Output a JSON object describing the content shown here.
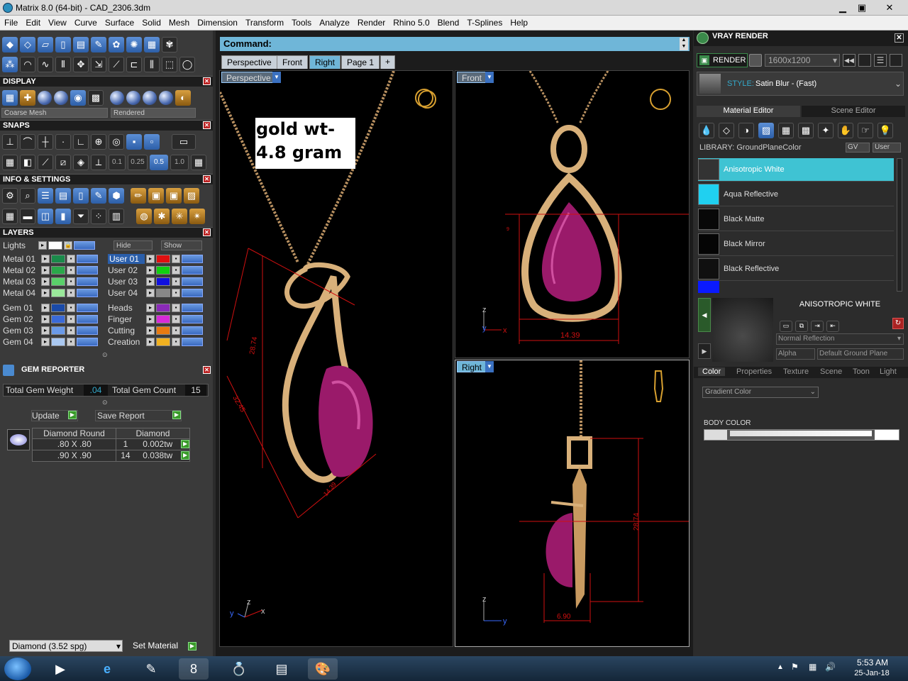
{
  "window": {
    "title": "Matrix 8.0 (64-bit) - CAD_2306.3dm",
    "minimize": "▁",
    "restore": "▣",
    "close": "✕"
  },
  "menu": [
    "File",
    "Edit",
    "View",
    "Curve",
    "Surface",
    "Solid",
    "Mesh",
    "Dimension",
    "Transform",
    "Tools",
    "Analyze",
    "Render",
    "Rhino 5.0",
    "Blend",
    "T-Splines",
    "Help"
  ],
  "left": {
    "display": {
      "title": "DISPLAY",
      "mesh_select": "Coarse Mesh",
      "mode_select": "Rendered"
    },
    "snaps": {
      "title": "SNAPS",
      "values": [
        "0.1",
        "0.25",
        "0.5",
        "1.0"
      ]
    },
    "info": {
      "title": "INFO & SETTINGS"
    },
    "layers": {
      "title": "LAYERS",
      "lights": "Lights",
      "hide": "Hide",
      "show": "Show",
      "left_col": [
        "Metal 01",
        "Metal 02",
        "Metal 03",
        "Metal 04",
        "Gem 01",
        "Gem 02",
        "Gem 03",
        "Gem 04"
      ],
      "right_col": [
        "User 01",
        "User 02",
        "User 03",
        "User 04",
        "Heads",
        "Finger",
        "Cutting",
        "Creation"
      ],
      "left_colors": [
        "#1a8a4a",
        "#2aa84a",
        "#5ad06a",
        "#9ae89a",
        "#1a4aa8",
        "#3a6ad8",
        "#6a9ae8",
        "#aac8f0"
      ],
      "right_colors": [
        "#e01010",
        "#10d010",
        "#1010e0",
        "#888888",
        "#8a2ab8",
        "#d82ad8",
        "#e87a10",
        "#f0b020"
      ]
    },
    "gem_reporter": {
      "title": "GEM REPORTER",
      "total_weight_label": "Total Gem Weight",
      "total_weight": ".04",
      "total_count_label": "Total Gem Count",
      "total_count": "15",
      "update": "Update",
      "save": "Save Report",
      "headers": [
        "Diamond Round",
        "Diamond"
      ],
      "rows": [
        {
          "size": ".80 X .80",
          "count": "1",
          "weight": "0.002tw"
        },
        {
          "size": ".90 X .90",
          "count": "14",
          "weight": "0.038tw"
        }
      ]
    },
    "material_select": "Diamond      (3.52 spg)",
    "set_material": "Set Material"
  },
  "viewports": {
    "command": "Command:",
    "tabs": [
      "Perspective",
      "Front",
      "Right",
      "Page 1"
    ],
    "add_tab": "+",
    "annotation": "gold wt-4.8 gram",
    "perspective": {
      "label": "Perspective",
      "dims": [
        "28.74",
        "32.45",
        "14.39"
      ]
    },
    "front": {
      "label": "Front",
      "dims": [
        "14.39",
        "9"
      ]
    },
    "right": {
      "label": "Right",
      "dims": [
        "28.74",
        "6.90"
      ]
    },
    "axis": {
      "x": "x",
      "y": "y",
      "z": "z"
    }
  },
  "right": {
    "title": "VRAY RENDER",
    "render_btn": "RENDER",
    "resolution": "1600x1200",
    "style_label": "STYLE:",
    "style_value": "Satin Blur - (Fast)",
    "tab_material": "Material Editor",
    "tab_scene": "Scene Editor",
    "library": "LIBRARY: GroundPlaneColor",
    "gv": "GV",
    "user": "User",
    "materials": [
      {
        "name": "Anisotropic White",
        "color": "#333333"
      },
      {
        "name": "Aqua Reflective",
        "color": "#20d0f0"
      },
      {
        "name": "Black Matte",
        "color": "#080808"
      },
      {
        "name": "Black Mirror",
        "color": "#050505"
      },
      {
        "name": "Black Reflective",
        "color": "#101010"
      }
    ],
    "selected_material": "ANISOTROPIC WHITE",
    "reflection_select": "Normal Reflection",
    "alpha": "Alpha",
    "ground_plane": "Default Ground Plane",
    "prop_tabs": [
      "Color",
      "Properties",
      "Texture",
      "Scene",
      "Toon",
      "Light"
    ],
    "color_mode": "Gradient Color",
    "body_color": "BODY COLOR"
  },
  "taskbar": {
    "time": "5:53 AM",
    "date": "25-Jan-18"
  }
}
